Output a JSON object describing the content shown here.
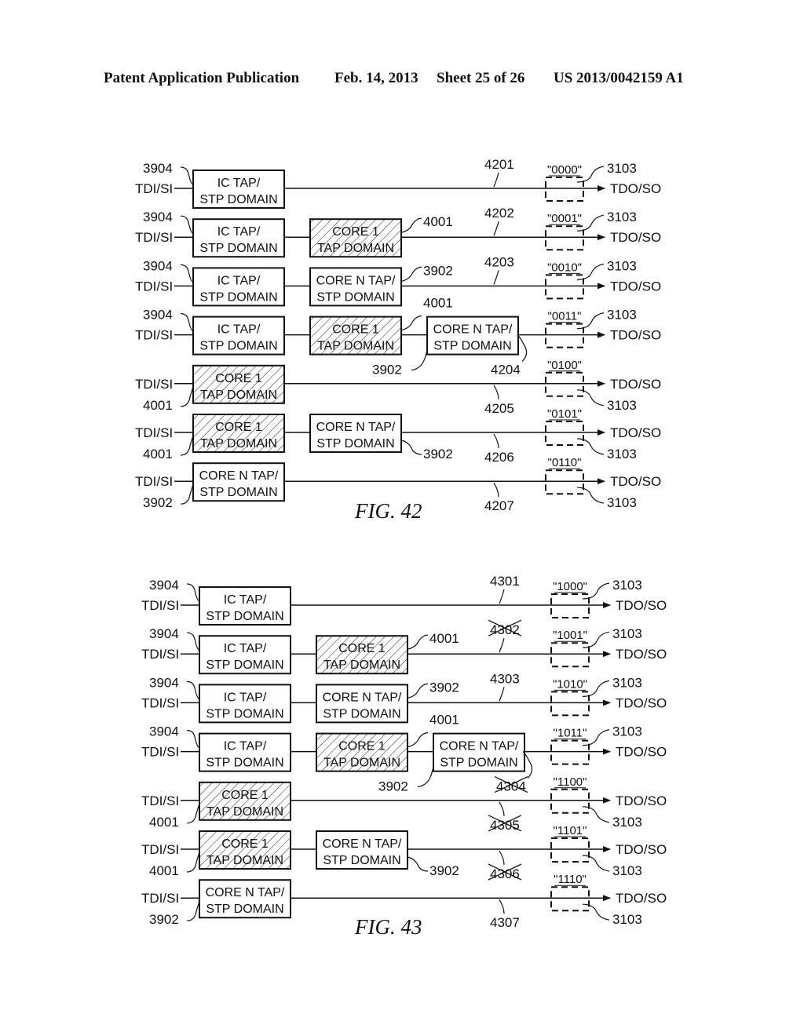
{
  "header": {
    "left": "Patent Application Publication",
    "date": "Feb. 14, 2013",
    "sheet": "Sheet 25 of 26",
    "number": "US 2013/0042159 A1"
  },
  "common": {
    "input_label": "TDI/SI",
    "output_label": "TDO/SO",
    "register_ref": "3103"
  },
  "box_types": {
    "ic": {
      "line1": "IC TAP/",
      "line2": "STP DOMAIN",
      "hatched": false
    },
    "core1": {
      "line1": "CORE 1",
      "line2": "TAP DOMAIN",
      "hatched": true
    },
    "coren": {
      "line1": "CORE N TAP/",
      "line2": "STP DOMAIN",
      "hatched": false
    }
  },
  "figures": [
    {
      "title": "FIG. 42",
      "rows": [
        {
          "boxes": [
            {
              "type": "ic",
              "ref": "3904"
            }
          ],
          "path_ref": "4201",
          "path_crossed": false,
          "code": "\"0000\""
        },
        {
          "boxes": [
            {
              "type": "ic",
              "ref": "3904"
            },
            {
              "type": "core1",
              "ref": "4001"
            }
          ],
          "path_ref": "4202",
          "path_crossed": false,
          "code": "\"0001\""
        },
        {
          "boxes": [
            {
              "type": "ic",
              "ref": "3904"
            },
            {
              "type": "coren",
              "ref": "3902"
            }
          ],
          "path_ref": "4203",
          "path_crossed": false,
          "code": "\"0010\""
        },
        {
          "boxes": [
            {
              "type": "ic",
              "ref": "3904"
            },
            {
              "type": "core1",
              "ref": "4001"
            },
            {
              "type": "coren",
              "ref": "3902"
            }
          ],
          "path_ref": "4204",
          "path_crossed": false,
          "code": "\"0011\""
        },
        {
          "boxes": [
            {
              "type": "core1",
              "ref": "4001"
            }
          ],
          "path_ref": "4205",
          "path_crossed": false,
          "code": "\"0100\""
        },
        {
          "boxes": [
            {
              "type": "core1",
              "ref": "4001"
            },
            {
              "type": "coren",
              "ref": "3902"
            }
          ],
          "path_ref": "4206",
          "path_crossed": false,
          "code": "\"0101\""
        },
        {
          "boxes": [
            {
              "type": "coren",
              "ref": "3902"
            }
          ],
          "path_ref": "4207",
          "path_crossed": false,
          "code": "\"0110\""
        }
      ]
    },
    {
      "title": "FIG. 43",
      "rows": [
        {
          "boxes": [
            {
              "type": "ic",
              "ref": "3904"
            }
          ],
          "path_ref": "4301",
          "path_crossed": false,
          "code": "\"1000\""
        },
        {
          "boxes": [
            {
              "type": "ic",
              "ref": "3904"
            },
            {
              "type": "core1",
              "ref": "4001"
            }
          ],
          "path_ref": "4302",
          "path_crossed": true,
          "code": "\"1001\""
        },
        {
          "boxes": [
            {
              "type": "ic",
              "ref": "3904"
            },
            {
              "type": "coren",
              "ref": "3902"
            }
          ],
          "path_ref": "4303",
          "path_crossed": false,
          "code": "\"1010\""
        },
        {
          "boxes": [
            {
              "type": "ic",
              "ref": "3904"
            },
            {
              "type": "core1",
              "ref": "4001"
            },
            {
              "type": "coren",
              "ref": "3902"
            }
          ],
          "path_ref": "4304",
          "path_crossed": true,
          "code": "\"1011\""
        },
        {
          "boxes": [
            {
              "type": "core1",
              "ref": "4001"
            }
          ],
          "path_ref": "4305",
          "path_crossed": true,
          "code": "\"1100\""
        },
        {
          "boxes": [
            {
              "type": "core1",
              "ref": "4001"
            },
            {
              "type": "coren",
              "ref": "3902"
            }
          ],
          "path_ref": "4306",
          "path_crossed": true,
          "code": "\"1101\""
        },
        {
          "boxes": [
            {
              "type": "coren",
              "ref": "3902"
            }
          ],
          "path_ref": "4307",
          "path_crossed": false,
          "code": "\"1110\""
        }
      ]
    }
  ]
}
